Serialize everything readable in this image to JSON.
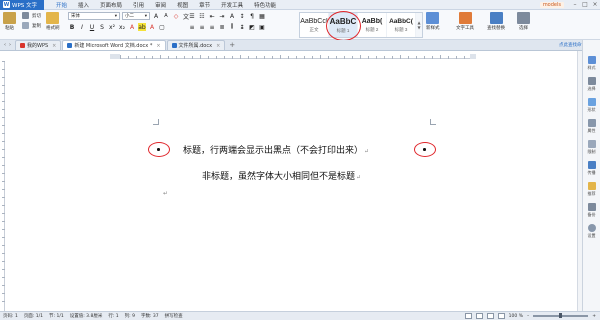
{
  "app": {
    "name": "WPS 文字",
    "logo": "W"
  },
  "menu": {
    "items": [
      "开始",
      "插入",
      "页面布局",
      "引用",
      "审阅",
      "视图",
      "章节",
      "开发工具",
      "特色功能"
    ],
    "active_index": 0
  },
  "window": {
    "user": "models",
    "min_glyph": "–",
    "max_glyph": "□",
    "close_glyph": "×"
  },
  "ribbon": {
    "paste": "粘贴",
    "cut": "剪切",
    "copy": "复制",
    "format_painter": "格式刷",
    "font_name": "宋体",
    "font_size": "小二",
    "bold": "B",
    "italic": "I",
    "underline": "U",
    "styles": [
      {
        "sample": "AaBbCcI",
        "name": "正文"
      },
      {
        "sample": "AaBbC",
        "name": "标题 1"
      },
      {
        "sample": "AaBb(",
        "name": "标题 2"
      },
      {
        "sample": "AaBbC(",
        "name": "标题 3"
      }
    ],
    "new_style": "新样式",
    "text_tools": "文字工具",
    "find_replace": "查找替换",
    "select": "选择"
  },
  "tabs": {
    "items": [
      {
        "label": "我的WPS",
        "color": "#d9342b",
        "active": false
      },
      {
        "label": "新建 Microsoft Word 文档.docx *",
        "color": "#2a6fc7",
        "active": true
      },
      {
        "label": "文件所属.docx",
        "color": "#2a6fc7",
        "active": false
      }
    ],
    "close_glyph": "×",
    "add_glyph": "+",
    "nav_prev": "‹",
    "nav_next": "›",
    "right_link": "点此查找命令"
  },
  "document": {
    "line1": "标题，行两端会显示出黑点（不会打印出来）",
    "line2": "非标题，虽然字体大小相同但不是标题",
    "para_mark": "↵"
  },
  "sidepanel": {
    "items": [
      "样式",
      "选择",
      "形状",
      "属性",
      "限制",
      "传播",
      "推荐",
      "备份",
      "设置"
    ]
  },
  "status": {
    "page_num": "页码: 1",
    "pages": "页面: 1/1",
    "section": "节: 1/1",
    "position": "设置值: 3.8厘米",
    "row": "行: 1",
    "col": "列: 9",
    "words": "字数: 37",
    "spell": "拼写检查",
    "zoom": "100 %",
    "zoom_minus": "–",
    "zoom_plus": "+",
    "zoom_level": 0.5
  },
  "colors": {
    "accent": "#2a6fc7",
    "annotation": "#e0262b"
  }
}
